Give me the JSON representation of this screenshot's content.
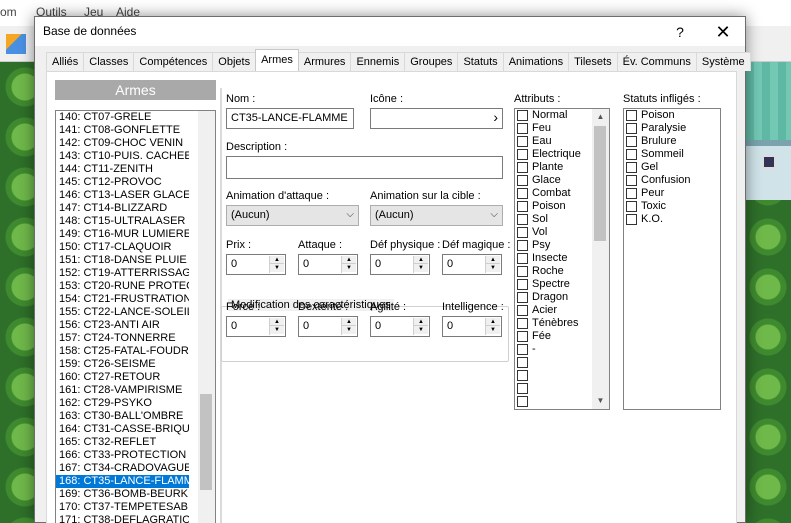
{
  "background": {
    "menu": [
      "om",
      "Outils",
      "Jeu",
      "Aide"
    ]
  },
  "dialog": {
    "title": "Base de données",
    "help_label": "?",
    "close_label": "✕"
  },
  "tabs": [
    "Alliés",
    "Classes",
    "Compétences",
    "Objets",
    "Armes",
    "Armures",
    "Ennemis",
    "Groupes",
    "Statuts",
    "Animations",
    "Tilesets",
    "Év. Communs",
    "Système"
  ],
  "active_tab": "Armes",
  "list": {
    "header": "Armes",
    "items": [
      "140: CT07-GRELE",
      "141: CT08-GONFLETTE",
      "142: CT09-CHOC VENIN",
      "143: CT10-PUIS. CACHEE",
      "144: CT11-ZENITH",
      "145: CT12-PROVOC",
      "146: CT13-LASER GLACE",
      "147: CT14-BLIZZARD",
      "148: CT15-ULTRALASER",
      "149: CT16-MUR LUMIERE",
      "150: CT17-CLAQUOIR",
      "151: CT18-DANSE PLUIE",
      "152: CT19-ATTERRISSAG",
      "153: CT20-RUNE PROTEC",
      "154: CT21-FRUSTRATION",
      "155: CT22-LANCE-SOLEIL",
      "156: CT23-ANTI AIR",
      "157: CT24-TONNERRE",
      "158: CT25-FATAL-FOUDR",
      "159: CT26-SEISME",
      "160: CT27-RETOUR",
      "161: CT28-VAMPIRISME",
      "162: CT29-PSYKO",
      "163: CT30-BALL'OMBRE",
      "164: CT31-CASSE-BRIQU",
      "165: CT32-REFLET",
      "166: CT33-PROTECTION",
      "167: CT34-CRADOVAGUE",
      "168: CT35-LANCE-FLAMM",
      "169: CT36-BOMB-BEURK",
      "170: CT37-TEMPETESABI",
      "171: CT38-DEFLAGRATIO"
    ],
    "selected_index": 28
  },
  "form": {
    "name_label": "Nom :",
    "name_value": "CT35-LANCE-FLAMME",
    "icon_label": "Icône :",
    "icon_button": "›",
    "description_label": "Description :",
    "description_value": "",
    "attack_anim_label": "Animation d'attaque :",
    "attack_anim_value": "(Aucun)",
    "target_anim_label": "Animation sur la cible :",
    "target_anim_value": "(Aucun)",
    "stats": [
      {
        "label": "Prix :",
        "value": "0"
      },
      {
        "label": "Attaque :",
        "value": "0"
      },
      {
        "label": "Déf physique :",
        "value": "0"
      },
      {
        "label": "Déf magique :",
        "value": "0"
      }
    ],
    "modif_title": "Modification des caractéristiques",
    "modifs": [
      {
        "label": "Force :",
        "value": "0"
      },
      {
        "label": "Dextérité :",
        "value": "0"
      },
      {
        "label": "Agilité :",
        "value": "0"
      },
      {
        "label": "Intelligence :",
        "value": "0"
      }
    ]
  },
  "attributes": {
    "label": "Attributs :",
    "items": [
      "Normal",
      "Feu",
      "Eau",
      "Electrique",
      "Plante",
      "Glace",
      "Combat",
      "Poison",
      "Sol",
      "Vol",
      "Psy",
      "Insecte",
      "Roche",
      "Spectre",
      "Dragon",
      "Acier",
      "Ténèbres",
      "Fée",
      "-",
      "",
      "",
      "",
      ""
    ]
  },
  "states": {
    "label": "Statuts infligés :",
    "items": [
      "Poison",
      "Paralysie",
      "Brulure",
      "Sommeil",
      "Gel",
      "Confusion",
      "Peur",
      "Toxic",
      "K.O."
    ]
  }
}
